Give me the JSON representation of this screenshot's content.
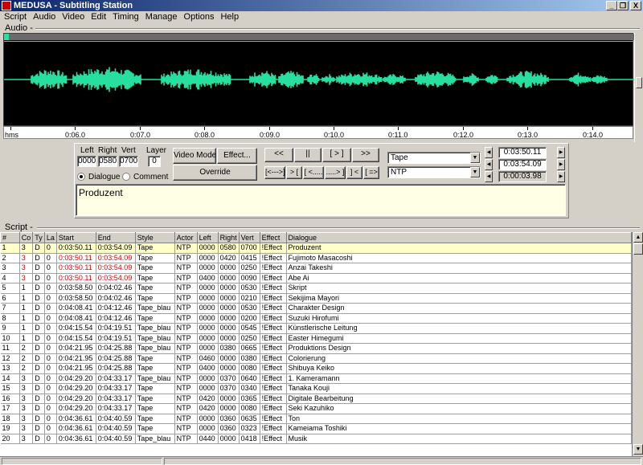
{
  "window": {
    "title": "MEDUSA - Subtitling Station",
    "minimize": "_",
    "restore": "❐",
    "close": "X"
  },
  "menu": [
    "Script",
    "Audio",
    "Video",
    "Edit",
    "Timing",
    "Manage",
    "Options",
    "Help"
  ],
  "audio": {
    "group_label": "Audio -",
    "waveform_color": "#27e0a0",
    "ruler_unit": "hms",
    "ruler_labels": [
      "0:06.0",
      "0:07.0",
      "0:08.0",
      "0:09.0",
      "0:10.0",
      "0:11.0",
      "0:12.0",
      "0:13.0",
      "0:14.0"
    ]
  },
  "editor": {
    "left_label": "Left",
    "right_label": "Right",
    "vert_label": "Vert",
    "layer_label": "Layer",
    "left_value": "0000",
    "right_value": "0580",
    "vert_value": "0700",
    "layer_value": "0",
    "radio_dialogue": "Dialogue",
    "radio_comment": "Comment",
    "selected_radio": "Dialogue",
    "video_mode": "Video Mode",
    "effect": "Effect...",
    "override": "Override",
    "transport": [
      "<<",
      "||",
      "[ > ]",
      ">>"
    ],
    "nav": [
      "[<--->]",
      "> [",
      "[ <.....",
      ".....> ]",
      "] <",
      "[ =>"
    ],
    "style_select": "Tape",
    "actor_select": "NTP",
    "start_time": "0:03:50.11",
    "end_time": "0:03:54.09",
    "duration": "0:00:03.98",
    "dialogue_text": "Produzent"
  },
  "script": {
    "group_label": "Script -",
    "columns": [
      "#",
      "Co",
      "Ty",
      "La",
      "Start",
      "End",
      "Style",
      "Actor",
      "Left",
      "Right",
      "Vert",
      "Effect",
      "Dialogue"
    ],
    "rows": [
      [
        "1",
        "3",
        "D",
        "0",
        "0:03:50.11",
        "0:03:54.09",
        "Tape",
        "NTP",
        "0000",
        "0580",
        "0700",
        "!Effect",
        "Produzent"
      ],
      [
        "2",
        "3",
        "D",
        "0",
        "0:03:50.11",
        "0:03:54.09",
        "Tape",
        "NTP",
        "0000",
        "0420",
        "0415",
        "!Effect",
        "Fujimoto Masacoshi"
      ],
      [
        "3",
        "3",
        "D",
        "0",
        "0:03:50.11",
        "0:03:54.09",
        "Tape",
        "NTP",
        "0000",
        "0000",
        "0250",
        "!Effect",
        "Anzai Takeshi"
      ],
      [
        "4",
        "3",
        "D",
        "0",
        "0:03:50.11",
        "0:03:54.09",
        "Tape",
        "NTP",
        "0400",
        "0000",
        "0090",
        "!Effect",
        "Abe  Ai"
      ],
      [
        "5",
        "1",
        "D",
        "0",
        "0:03:58.50",
        "0:04:02.46",
        "Tape",
        "NTP",
        "0000",
        "0000",
        "0530",
        "!Effect",
        "Skript"
      ],
      [
        "6",
        "1",
        "D",
        "0",
        "0:03:58.50",
        "0:04:02.46",
        "Tape",
        "NTP",
        "0000",
        "0000",
        "0210",
        "!Effect",
        "Sekijima Mayori"
      ],
      [
        "7",
        "1",
        "D",
        "0",
        "0:04:08.41",
        "0:04:12.46",
        "Tape_blau",
        "NTP",
        "0000",
        "0000",
        "0530",
        "!Effect",
        "Charakter Design"
      ],
      [
        "8",
        "1",
        "D",
        "0",
        "0:04:08.41",
        "0:04:12.46",
        "Tape",
        "NTP",
        "0000",
        "0000",
        "0200",
        "!Effect",
        "Suzuki Hirofumi"
      ],
      [
        "9",
        "1",
        "D",
        "0",
        "0:04:15.54",
        "0:04:19.51",
        "Tape_blau",
        "NTP",
        "0000",
        "0000",
        "0545",
        "!Effect",
        "Künstlerische Leitung"
      ],
      [
        "10",
        "1",
        "D",
        "0",
        "0:04:15.54",
        "0:04:19.51",
        "Tape_blau",
        "NTP",
        "0000",
        "0000",
        "0250",
        "!Effect",
        "Easter        Himegumi"
      ],
      [
        "11",
        "2",
        "D",
        "0",
        "0:04:21.95",
        "0:04:25.88",
        "Tape_blau",
        "NTP",
        "0000",
        "0380",
        "0665",
        "!Effect",
        "Produktions Design"
      ],
      [
        "12",
        "2",
        "D",
        "0",
        "0:04:21.95",
        "0:04:25.88",
        "Tape",
        "NTP",
        "0460",
        "0000",
        "0380",
        "!Effect",
        "Colorierung"
      ],
      [
        "13",
        "2",
        "D",
        "0",
        "0:04:21.95",
        "0:04:25.88",
        "Tape",
        "NTP",
        "0400",
        "0000",
        "0080",
        "!Effect",
        "Shibuya Keiko"
      ],
      [
        "14",
        "3",
        "D",
        "0",
        "0:04:29.20",
        "0:04:33.17",
        "Tape_blau",
        "NTP",
        "0000",
        "0370",
        "0640",
        "!Effect",
        "1. Kameramann"
      ],
      [
        "15",
        "3",
        "D",
        "0",
        "0:04:29.20",
        "0:04:33.17",
        "Tape",
        "NTP",
        "0000",
        "0370",
        "0340",
        "!Effect",
        "Tanaka Kouji"
      ],
      [
        "16",
        "3",
        "D",
        "0",
        "0:04:29.20",
        "0:04:33.17",
        "Tape",
        "NTP",
        "0420",
        "0000",
        "0365",
        "!Effect",
        "Digitale Bearbeitung"
      ],
      [
        "17",
        "3",
        "D",
        "0",
        "0:04:29.20",
        "0:04:33.17",
        "Tape",
        "NTP",
        "0420",
        "0000",
        "0080",
        "!Effect",
        "Seki Kazuhiko"
      ],
      [
        "18",
        "3",
        "D",
        "0",
        "0:04:36.61",
        "0:04:40.59",
        "Tape",
        "NTP",
        "0000",
        "0360",
        "0635",
        "!Effect",
        "Ton"
      ],
      [
        "19",
        "3",
        "D",
        "0",
        "0:04:36.61",
        "0:04:40.59",
        "Tape",
        "NTP",
        "0000",
        "0360",
        "0323",
        "!Effect",
        "Kameiama  Toshiki"
      ],
      [
        "20",
        "3",
        "D",
        "0",
        "0:04:36.61",
        "0:04:40.59",
        "Tape_blau",
        "NTP",
        "0440",
        "0000",
        "0418",
        "!Effect",
        "Musik"
      ]
    ],
    "red_rows": [
      2,
      3,
      4
    ],
    "selected_row": 1
  },
  "colors": {
    "selected_row_bg": "#ffffc8",
    "red_text": "#e00000",
    "waveform": "#27e0a0"
  }
}
